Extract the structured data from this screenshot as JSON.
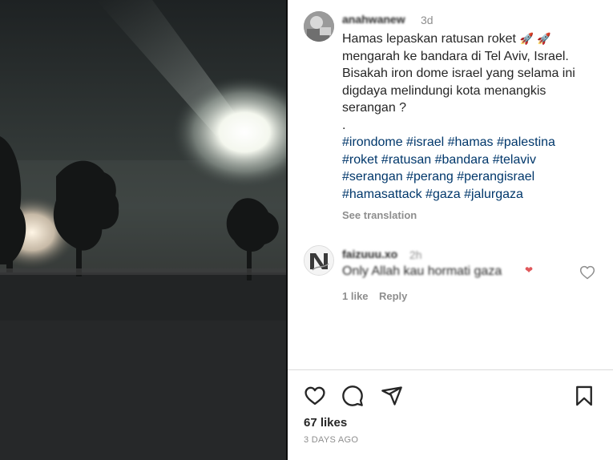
{
  "post": {
    "username": "anahwanew",
    "time": "3d",
    "caption_lines": [
      "Hamas lepaskan ratusan roket",
      "mengarah ke bandara di Tel Aviv, Israel.",
      "Bisakah iron dome israel yang selama ini",
      "digdaya melindungi kota menangkis",
      "serangan ?",
      "."
    ],
    "hashtag_lines": [
      "#irondome #israel #hamas #palestina",
      "#roket #ratusan #bandara #telaviv",
      "#serangan #perang #perangisrael",
      "#hamasattack #gaza #jalurgaza"
    ],
    "see_translation": "See translation",
    "rocket_icon": "rocket-emoji"
  },
  "comment": {
    "username": "faizuuu.xo",
    "time": "2h",
    "text": "Only Allah kau hormati gaza",
    "likes": "1 like",
    "reply": "Reply",
    "heart_icon": "heart-outline-icon"
  },
  "actions": {
    "like_icon": "heart-icon",
    "comment_icon": "comment-icon",
    "share_icon": "share-icon",
    "save_icon": "bookmark-icon"
  },
  "stats": {
    "likes": "67 likes",
    "date": "3 DAYS AGO"
  }
}
